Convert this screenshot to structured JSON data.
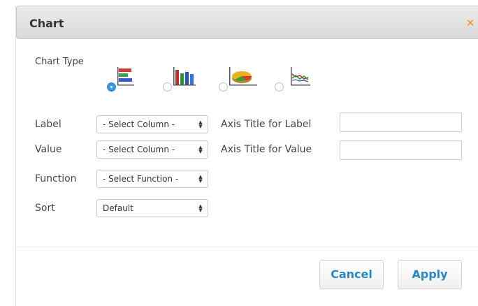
{
  "dialog": {
    "title": "Chart",
    "close_icon": "close-x-icon",
    "accent_color": "#ff8c1a"
  },
  "chart_type": {
    "label": "Chart Type",
    "options": [
      {
        "id": "horizontal-bar",
        "icon": "horizontal-bar-chart-icon",
        "selected": true
      },
      {
        "id": "vertical-bar",
        "icon": "vertical-bar-chart-icon",
        "selected": false
      },
      {
        "id": "pie",
        "icon": "pie-chart-icon",
        "selected": false
      },
      {
        "id": "line",
        "icon": "line-chart-icon",
        "selected": false
      }
    ]
  },
  "fields": {
    "label": {
      "label": "Label",
      "selected": "- Select Column -"
    },
    "value": {
      "label": "Value",
      "selected": "- Select Column -"
    },
    "function": {
      "label": "Function",
      "selected": "- Select Function -"
    },
    "sort": {
      "label": "Sort",
      "selected": "Default"
    }
  },
  "axis": {
    "label_title": {
      "label": "Axis Title for Label",
      "value": ""
    },
    "value_title": {
      "label": "Axis Title for Value",
      "value": ""
    }
  },
  "buttons": {
    "cancel": "Cancel",
    "apply": "Apply",
    "color": "#2586c4"
  }
}
